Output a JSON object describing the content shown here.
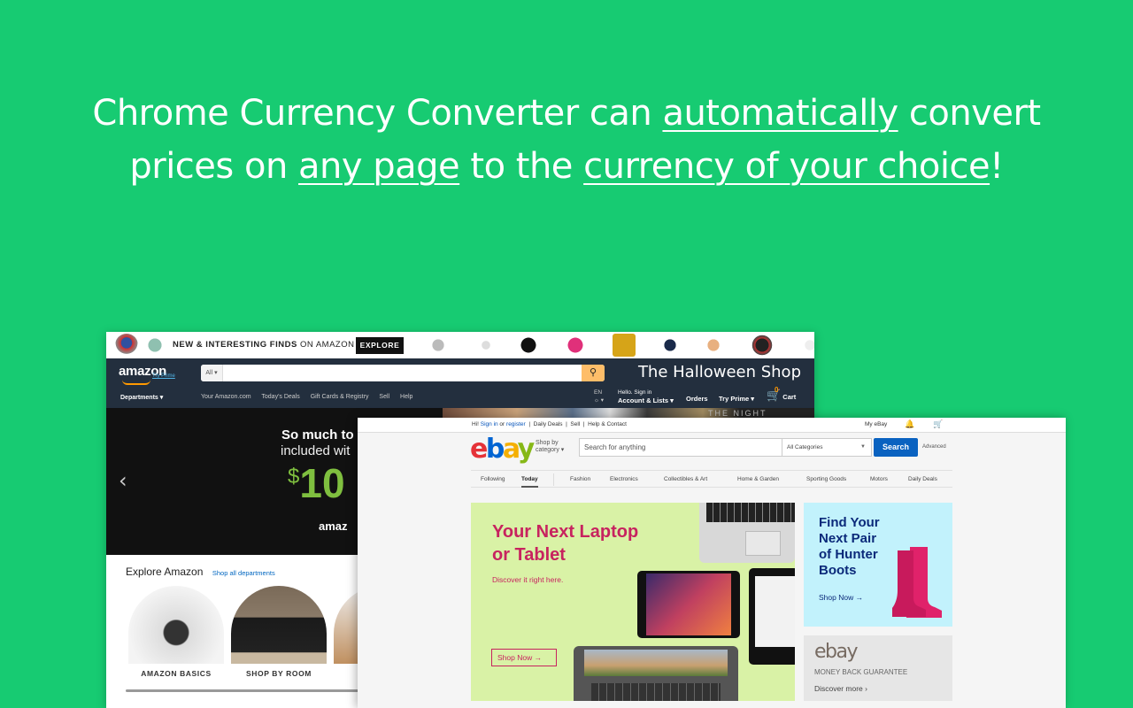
{
  "headline": {
    "part1": "Chrome Currency Converter can ",
    "emph1": "automatically",
    "part2": " convert",
    "part3": "prices on ",
    "emph2": "any page",
    "part4": " to the ",
    "emph3": "currency of your choice",
    "part5": "!"
  },
  "colors": {
    "background": "#17cb72",
    "amazon_nav": "#232f3e",
    "ebay_search": "#0a62c0"
  },
  "amazon": {
    "promo_bold": "NEW & INTERESTING FINDS",
    "promo_light": " ON AMAZON",
    "explore_button": "EXPLORE",
    "logo": "amazon",
    "try_prime_link": "Try Prime",
    "search_category": "All ▾",
    "search_icon": "search-icon",
    "shop_banner": "The Halloween Shop",
    "departments": "Departments ▾",
    "nav_links": [
      "Your Amazon.com",
      "Today's Deals",
      "Gift Cards & Registry",
      "Sell",
      "Help"
    ],
    "language": "EN",
    "language_icon": "globe-icon",
    "greeting": "Hello. Sign in",
    "account": "Account & Lists ▾",
    "orders": "Orders",
    "try_prime_menu": "Try Prime ▾",
    "cart_count": "0",
    "cart_label": "Cart",
    "hero_strip_text": "THE NIGHT MANAGER",
    "hero_line1": "So much to",
    "hero_line2": "included wit",
    "hero_currency": "$",
    "hero_price": "10",
    "hero_logo": "amaz",
    "explore_title": "Explore Amazon",
    "explore_link": "Shop all departments",
    "categories": [
      "AMAZON BASICS",
      "SHOP BY ROOM"
    ]
  },
  "ebay": {
    "greeting_prefix": "Hi! ",
    "sign_in": "Sign in",
    "or": " or ",
    "register": "register",
    "top_links": "  |  Daily Deals  |  Sell  |  Help & Contact",
    "my_ebay": "My eBay",
    "logo": {
      "e": "e",
      "b": "b",
      "a": "a",
      "y": "y"
    },
    "shop_by": "Shop by",
    "category": "category ▾",
    "search_placeholder": "Search for anything",
    "category_select": "All Categories",
    "search_button": "Search",
    "advanced": "Advanced",
    "nav": [
      "Following",
      "Today",
      "Fashion",
      "Electronics",
      "Collectibles & Art",
      "Home & Garden",
      "Sporting Goods",
      "Motors",
      "Daily Deals"
    ],
    "banner1": {
      "title_line1": "Your Next Laptop",
      "title_line2": "or Tablet",
      "subtitle": "Discover it right here.",
      "button": "Shop Now →"
    },
    "banner2": {
      "title_lines": [
        "Find Your",
        "Next Pair",
        "of Hunter",
        "Boots"
      ],
      "button": "Shop Now →"
    },
    "banner3": {
      "logo": "ebay",
      "subtitle": "MONEY BACK GUARANTEE",
      "link": "Discover more ›"
    }
  }
}
